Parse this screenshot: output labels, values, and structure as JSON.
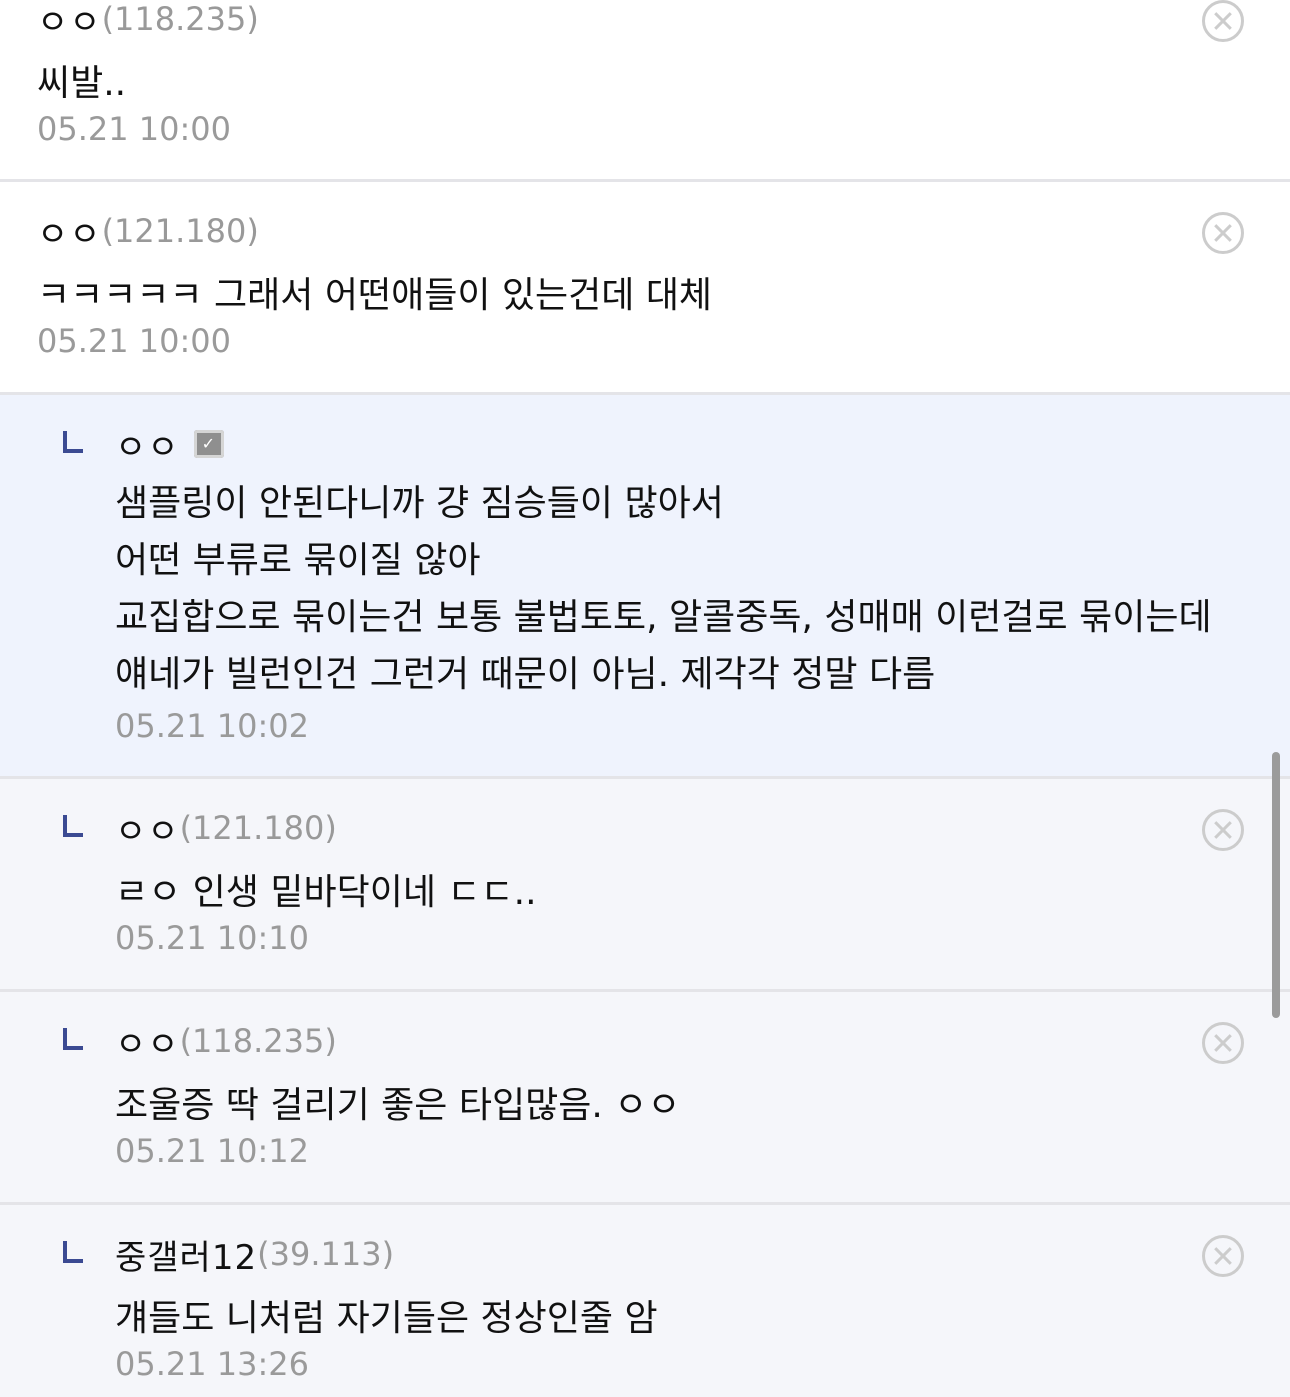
{
  "comments": [
    {
      "nick": "ㅇㅇ",
      "ip": "(118.235)",
      "lines": [
        "씨발.."
      ],
      "date": "05.21 10:00"
    },
    {
      "nick": "ㅇㅇ",
      "ip": "(121.180)",
      "lines": [
        "ㅋㅋㅋㅋㅋ 그래서 어떤애들이 있는건데 대체"
      ],
      "date": "05.21 10:00"
    },
    {
      "nick": "ㅇㅇ",
      "ip": "",
      "gonick_icon": "user-badge-icon",
      "lines": [
        "샘플링이 안된다니까 걍 짐승들이 많아서",
        "어떤 부류로 묶이질 않아",
        "교집합으로 묶이는건 보통 불법토토, 알콜중독, 성매매 이런걸로 묶이는데",
        "얘네가 빌런인건 그런거 때문이 아님. 제각각 정말 다름"
      ],
      "date": "05.21 10:02"
    },
    {
      "nick": "ㅇㅇ",
      "ip": "(121.180)",
      "lines": [
        "ㄹㅇ 인생 밑바닥이네 ㄷㄷ.."
      ],
      "date": "05.21 10:10"
    },
    {
      "nick": "ㅇㅇ",
      "ip": "(118.235)",
      "lines": [
        "조울증 딱 걸리기 좋은 타입많음. ㅇㅇ"
      ],
      "date": "05.21 10:12"
    },
    {
      "nick": "중갤러12",
      "ip": "(39.113)",
      "lines": [
        "걔들도 니처럼 자기들은 정상인줄 암"
      ],
      "date": "05.21 13:26"
    }
  ],
  "colors": {
    "reply_mark": "#3b4a92",
    "highlight_bg": "#eff3fd",
    "reply_bg": "#f5f6fa",
    "meta_text": "#999999"
  }
}
